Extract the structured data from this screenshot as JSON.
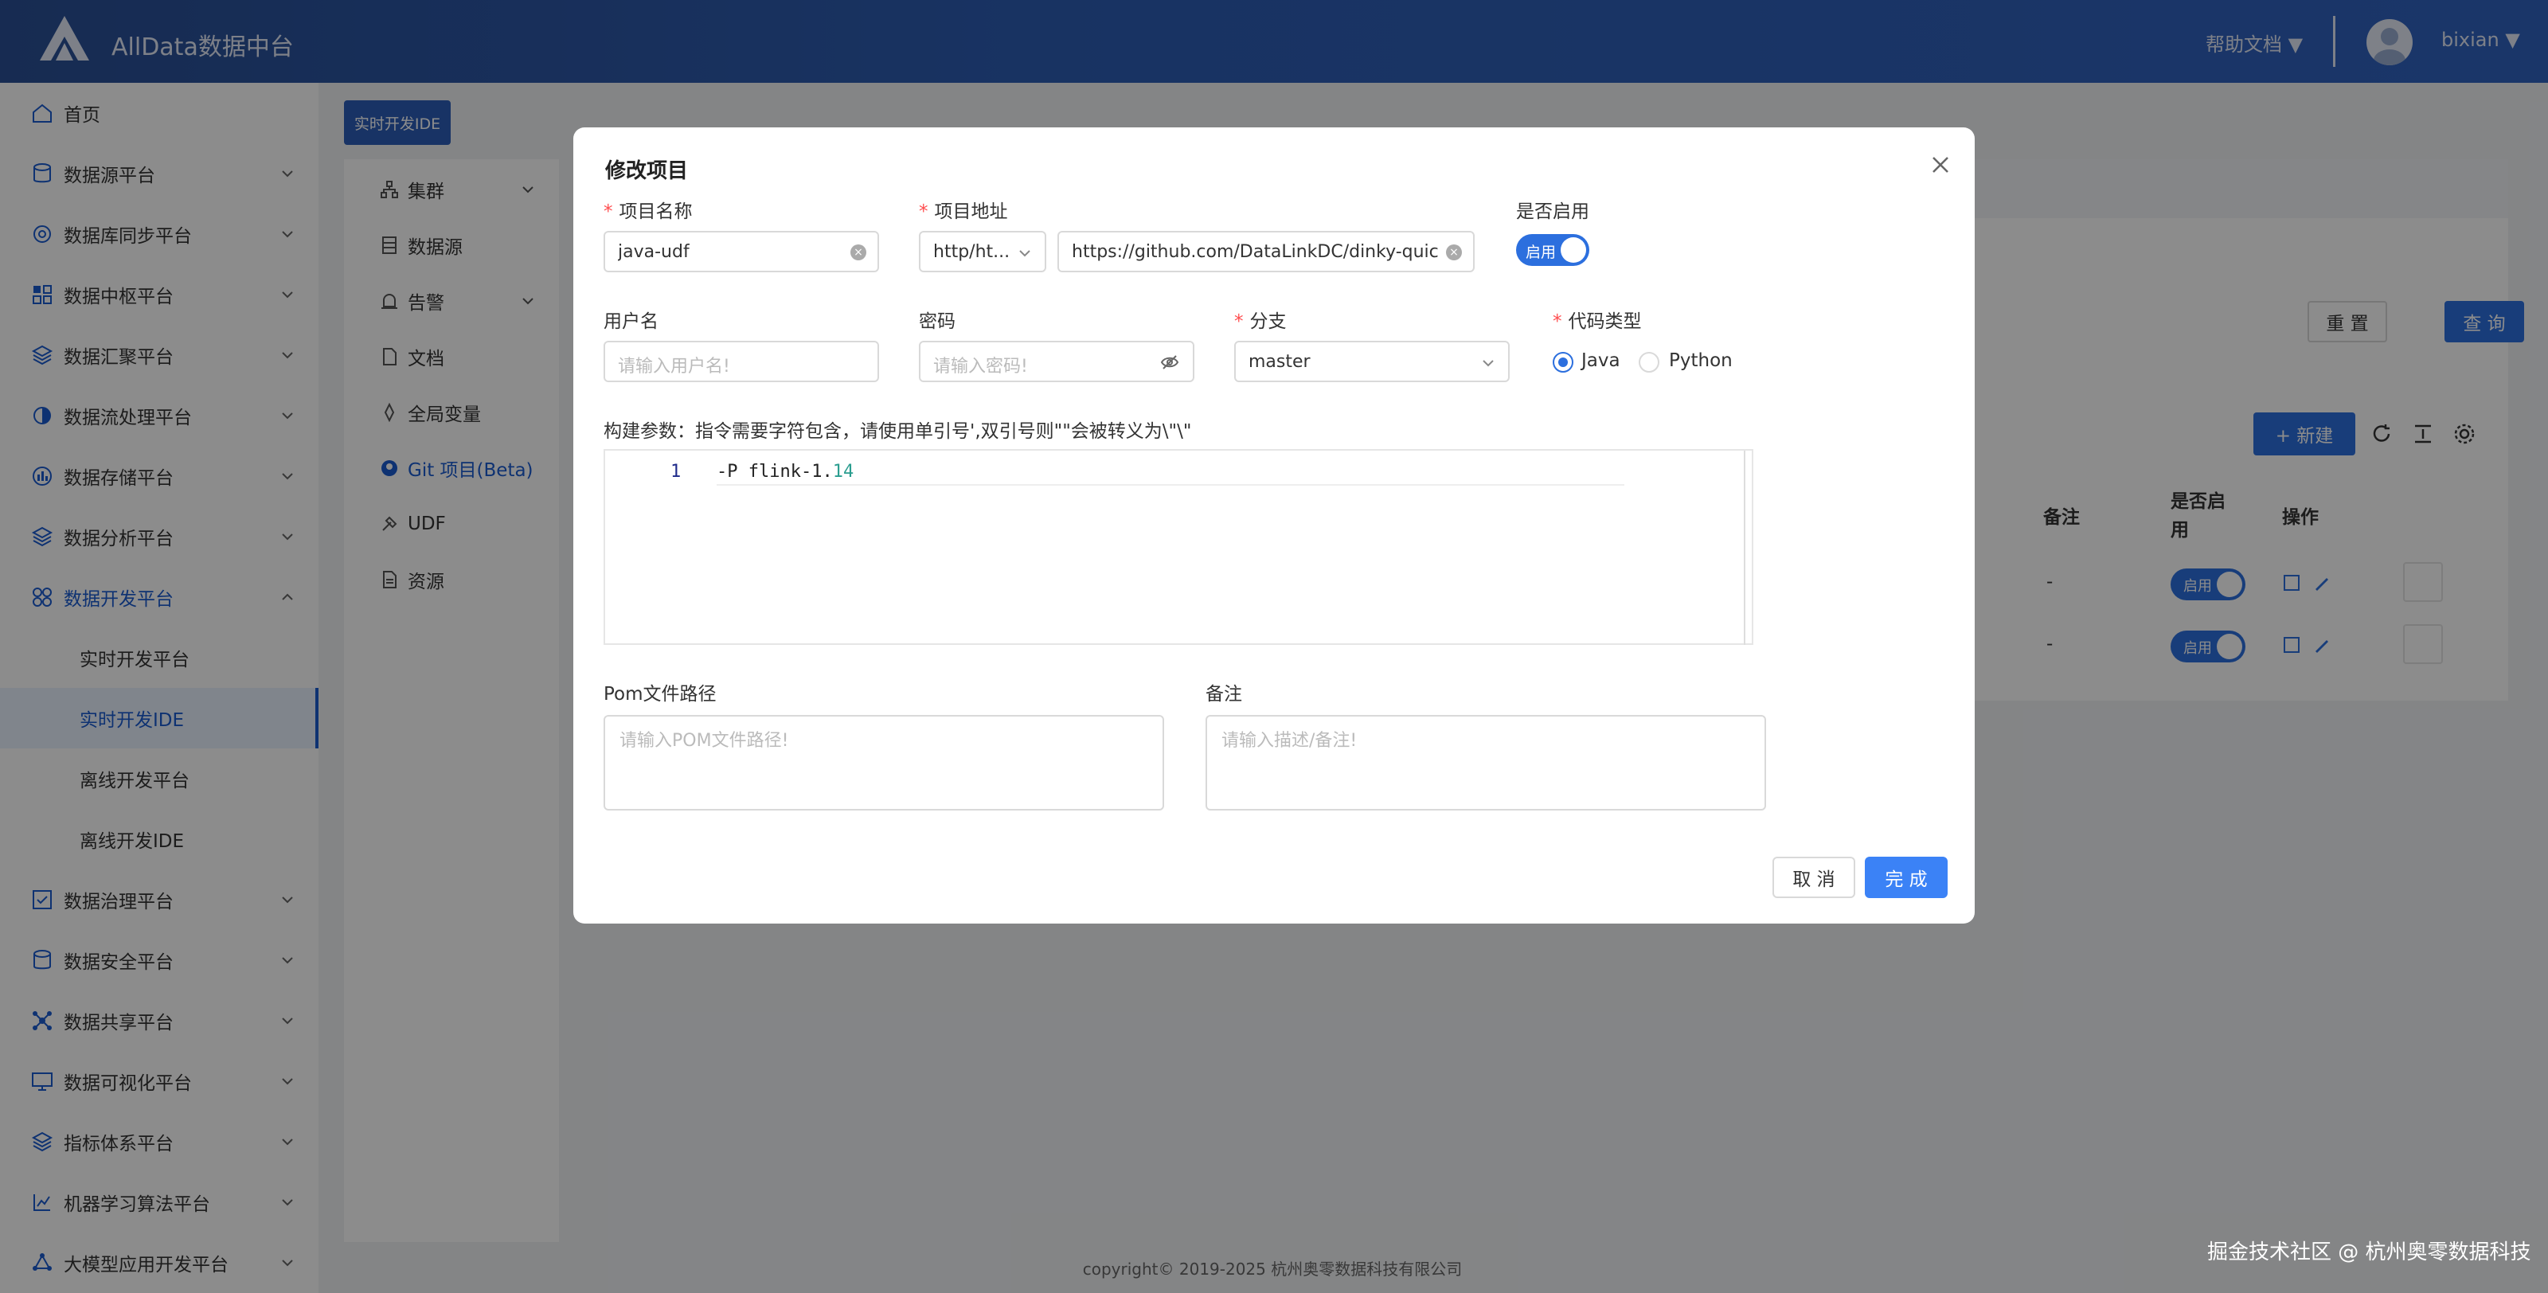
{
  "header": {
    "app_title": "AllData数据中台",
    "help_label": "帮助文档 ▼",
    "user_label": "bixian ▼"
  },
  "sidebar": {
    "items": [
      {
        "label": "首页",
        "icon": "home-icon"
      },
      {
        "label": "数据源平台",
        "icon": "database-icon"
      },
      {
        "label": "数据库同步平台",
        "icon": "sync-icon"
      },
      {
        "label": "数据中枢平台",
        "icon": "grid-icon"
      },
      {
        "label": "数据汇聚平台",
        "icon": "layers-icon"
      },
      {
        "label": "数据流处理平台",
        "icon": "flow-icon"
      },
      {
        "label": "数据存储平台",
        "icon": "storage-icon"
      },
      {
        "label": "数据分析平台",
        "icon": "analysis-icon"
      },
      {
        "label": "数据开发平台",
        "icon": "dev-icon"
      },
      {
        "label": "实时开发平台"
      },
      {
        "label": "实时开发IDE"
      },
      {
        "label": "离线开发平台"
      },
      {
        "label": "离线开发IDE"
      },
      {
        "label": "数据治理平台",
        "icon": "governance-icon"
      },
      {
        "label": "数据安全平台",
        "icon": "security-icon"
      },
      {
        "label": "数据共享平台",
        "icon": "share-icon"
      },
      {
        "label": "数据可视化平台",
        "icon": "visual-icon"
      },
      {
        "label": "指标体系平台",
        "icon": "metric-icon"
      },
      {
        "label": "机器学习算法平台",
        "icon": "ml-icon"
      },
      {
        "label": "大模型应用开发平台",
        "icon": "llm-icon"
      }
    ]
  },
  "page": {
    "tag_label": "实时开发IDE",
    "subnav": [
      {
        "label": "集群",
        "icon": "cluster-icon"
      },
      {
        "label": "数据源",
        "icon": "datasource-icon"
      },
      {
        "label": "告警",
        "icon": "alarm-icon"
      },
      {
        "label": "文档",
        "icon": "doc-icon"
      },
      {
        "label": "全局变量",
        "icon": "variable-icon"
      },
      {
        "label": "Git 项目(Beta)",
        "icon": "github-icon"
      },
      {
        "label": "UDF",
        "icon": "udf-icon"
      },
      {
        "label": "资源",
        "icon": "resource-icon"
      }
    ],
    "reset_label": "重 置",
    "query_label": "查 询",
    "new_label": "+ 新建",
    "table_headers": {
      "remark": "备注",
      "enabled": "是否启用",
      "actions": "操作"
    },
    "rows": [
      {
        "remark": "-",
        "enabled": "启用"
      },
      {
        "remark": "-",
        "enabled": "启用"
      }
    ]
  },
  "footer": "copyright© 2019-2025 杭州奥零数据科技有限公司",
  "watermark": "掘金技术社区 @ 杭州奥零数据科技",
  "modal": {
    "title": "修改项目",
    "fields": {
      "name_label": "项目名称",
      "name_value": "java-udf",
      "url_label": "项目地址",
      "protocol_value": "http/ht...",
      "url_value": "https://github.com/DataLinkDC/dinky-quickst",
      "enabled_label": "是否启用",
      "enabled_value": "启用",
      "username_label": "用户名",
      "username_placeholder": "请输入用户名!",
      "password_label": "密码",
      "password_placeholder": "请输入密码!",
      "branch_label": "分支",
      "branch_value": "master",
      "code_type_label": "代码类型",
      "code_type_options": [
        "Java",
        "Python"
      ],
      "build_args_label": "构建参数：指令需要字符包含，请使用单引号',双引号则\"\"会被转义为\\\"\\\"",
      "code_line_no": "1",
      "code_text": "-P flink-1.",
      "code_num": "14",
      "pom_label": "Pom文件路径",
      "pom_placeholder": "请输入POM文件路径!",
      "remark_label": "备注",
      "remark_placeholder": "请输入描述/备注!"
    },
    "cancel_label": "取 消",
    "ok_label": "完 成"
  }
}
